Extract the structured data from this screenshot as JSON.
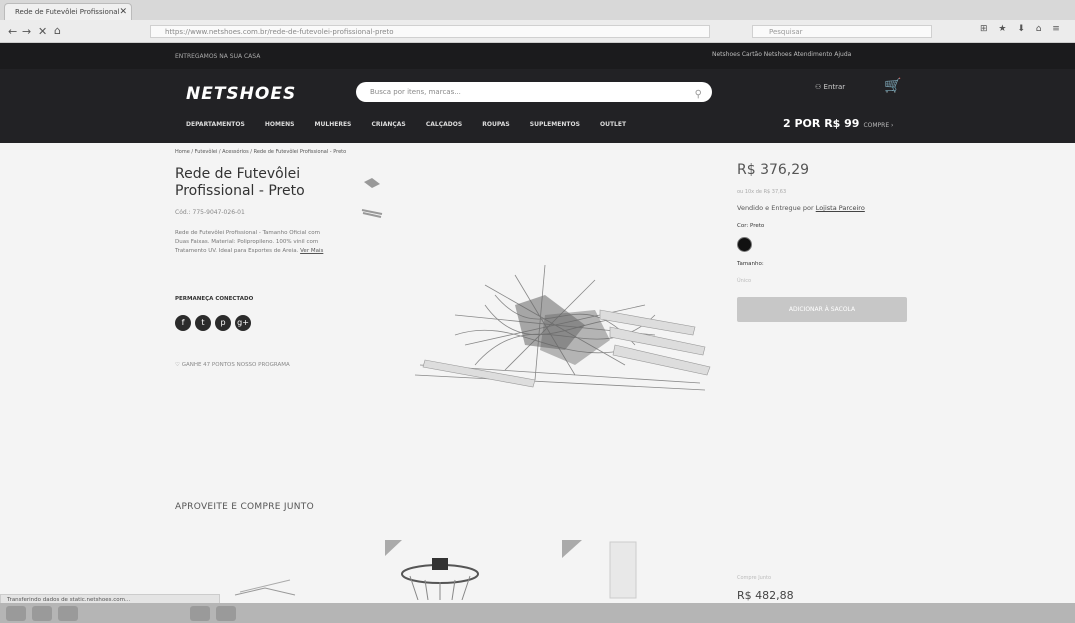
{
  "browser": {
    "tab_title": "Rede de Futevôlei Profissional",
    "tab_close": "✕",
    "back": "←",
    "forward": "→",
    "close_btn": "✕",
    "home": "⌂",
    "url": "https://www.netshoes.com.br/rede-de-futevolei-profissional-preto",
    "search_placeholder": "Pesquisar",
    "icons": "⊞ ★ ⬇ ⌂ ≡"
  },
  "site": {
    "promo": "ENTREGAMOS NA SUA CASA",
    "top_links": "Netshoes   Cartão Netshoes   Atendimento   Ajuda",
    "logo": "NETSHOES",
    "search_placeholder": "Busca por itens, marcas...",
    "login": "Entrar",
    "categories": [
      "DEPARTAMENTOS",
      "HOMENS",
      "MULHERES",
      "CRIANÇAS",
      "CALÇADOS",
      "ROUPAS",
      "SUPLEMENTOS",
      "OUTLET"
    ],
    "deal": "2 POR R$ 99",
    "deal_link": "COMPRE ›"
  },
  "product": {
    "breadcrumb": "Home / Futevôlei / Acessórios / Rede de Futevôlei Profissional - Preto",
    "title": "Rede de Futevôlei Profissional - Preto",
    "ref": "Cód.: 775-9047-026-01",
    "description": "Rede de Futevôlei Profissional - Tamanho Oficial com Duas Faixas. Material: Polipropileno. 100% vinil com Tratamento UV. Ideal para Esportes de Areia.",
    "more_link": "Ver Mais",
    "connect": "PERMANEÇA CONECTADO",
    "social": [
      "f",
      "t",
      "p",
      "g+"
    ],
    "points": "GANHE 47 PONTOS NOSSO PROGRAMA",
    "price": "R$ 376,29",
    "subprice": "ou 10x de R$ 37,63",
    "sold_by_prefix": "Vendido e Entregue por",
    "seller": "Lojista Parceiro",
    "color_label": "Cor: Preto",
    "size_label": "Tamanho:",
    "size_value": "Único",
    "buy_label": "ADICIONAR À SACOLA"
  },
  "combo": {
    "title": "APROVEITE E COMPRE JUNTO",
    "label": "Compre Junto",
    "price": "R$ 482,88"
  },
  "status": "Transferindo dados de static.netshoes.com..."
}
